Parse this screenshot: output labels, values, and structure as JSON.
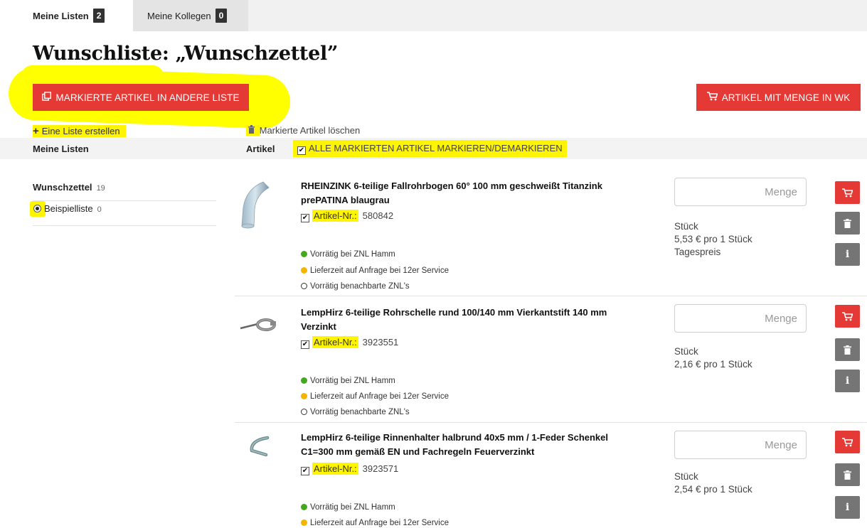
{
  "tabs": [
    {
      "label": "Meine Listen",
      "count": "2"
    },
    {
      "label": "Meine Kollegen",
      "count": "0"
    }
  ],
  "page_title": "Wunschliste: „Wunschzettel”",
  "toolbar": {
    "move_label": "MARKIERTE ARTIKEL IN ANDERE LISTE",
    "add_all_to_cart_label": "ARTIKEL MIT MENGE IN WK",
    "create_list_label": "Eine Liste erstellen",
    "delete_marked_label": "Markierte Artikel löschen"
  },
  "header": {
    "lists_label": "Meine Listen",
    "articles_label": "Artikel",
    "toggle_all_label": "ALLE MARKIERTEN ARTIKEL MARKIEREN/DEMARKIEREN"
  },
  "lists": [
    {
      "name": "Wunschzettel",
      "count": "19"
    },
    {
      "name": "Beispielliste",
      "count": "0"
    }
  ],
  "products": [
    {
      "name": "RHEINZINK 6-teilige Fallrohrbogen 60° 100 mm geschweißt Titanzink prePATINA blaugrau",
      "art_label": "Artikel-Nr.:",
      "art_no": "580842",
      "stock1": "Vorrätig bei ZNL Hamm",
      "stock2": "Lieferzeit auf Anfrage bei 12er Service",
      "stock3": "Vorrätig benachbarte ZNL's",
      "qty_placeholder": "Menge",
      "unit": "Stück",
      "price": "5,53 € pro  1  Stück",
      "price_note": "Tagespreis"
    },
    {
      "name": "LempHirz 6-teilige Rohrschelle rund 100/140 mm Vierkantstift 140 mm Verzinkt",
      "art_label": "Artikel-Nr.:",
      "art_no": "3923551",
      "stock1": "Vorrätig bei ZNL Hamm",
      "stock2": "Lieferzeit auf Anfrage bei 12er Service",
      "stock3": "Vorrätig benachbarte ZNL's",
      "qty_placeholder": "Menge",
      "unit": "Stück",
      "price": "2,16 € pro  1  Stück"
    },
    {
      "name": "LempHirz 6-teilige Rinnenhalter halbrund 40x5 mm / 1-Feder Schenkel C1=300 mm gemäß EN und Fachregeln Feuerverzinkt",
      "art_label": "Artikel-Nr.:",
      "art_no": "3923571",
      "stock1": "Vorrätig bei ZNL Hamm",
      "stock2": "Lieferzeit auf Anfrage bei 12er Service",
      "qty_placeholder": "Menge",
      "unit": "Stück",
      "price": "2,54 € pro  1  Stück"
    }
  ],
  "colors": {
    "accent": "#e53935",
    "highlight": "#fff500",
    "in_stock": "#43a820",
    "on_request": "#f5b400"
  }
}
